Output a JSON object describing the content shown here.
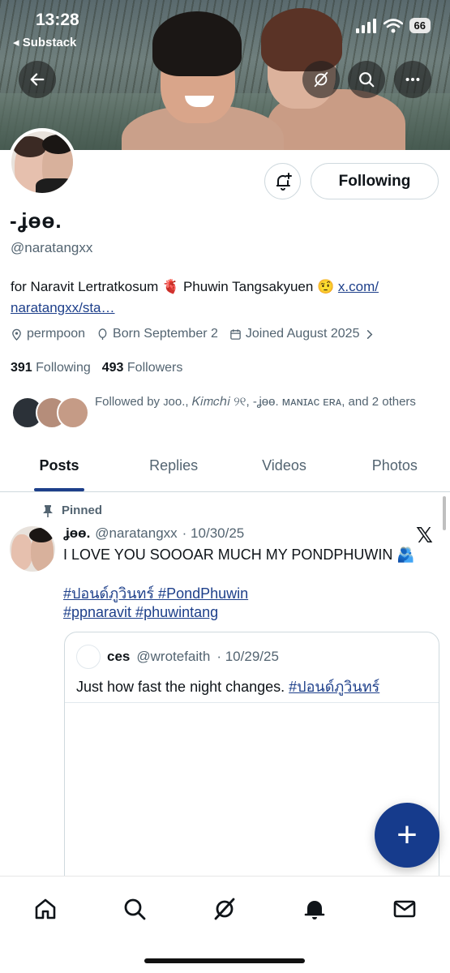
{
  "status_bar": {
    "time": "13:28",
    "back_app": "◂ Substack",
    "battery": "66"
  },
  "header": {
    "back_icon": "arrow-left-icon",
    "grok_icon": "grok-icon",
    "search_icon": "search-icon",
    "more_icon": "more-icon"
  },
  "profile": {
    "display_name": "-ʝɵɵ.",
    "handle": "@naratangxx",
    "bio_text": "for Naravit Lertratkosum 🫀 Phuwin Tangsakyuen 🤨 ",
    "bio_link": "x.com/ naratangxx/sta…",
    "location": "permpoon",
    "birthday": "Born September 2",
    "joined": "Joined August 2025",
    "following_count": "391",
    "following_label": "Following",
    "followers_count": "493",
    "followers_label": "Followers",
    "followed_by": "Followed by ᴊᴏᴏ., 𝐾𝑖𝑚𝑐ℎ𝑖 ୨୧, -ʝɵɵ. ᴍᴀɴɪᴀᴄ ᴇʀᴀ, and 2 others",
    "follow_button": "Following",
    "bell_icon": "bell-plus-icon"
  },
  "tabs": [
    "Posts",
    "Replies",
    "Videos",
    "Photos"
  ],
  "post": {
    "pinned_label": "Pinned",
    "author_name": "ʝɵɵ.",
    "author_handle": "@naratangxx",
    "date": "· 10/30/25",
    "text": "I LOVE YOU SOOOAR MUCH MY PONDPHUWIN 🫂",
    "hashtags_line1": "#ปอนด์ภูวินทร์ #PondPhuwin",
    "hashtags_line2": "#ppnaravit #phuwintang",
    "source_logo": "𝕏",
    "quote": {
      "name": "ces",
      "handle": "@wrotefaith",
      "date": "· 10/29/25",
      "text": "Just how fast the night changes. ",
      "hashtag": "#ปอนด์ภูวินทร์"
    }
  },
  "fab": {
    "label": "+"
  },
  "bottom_nav": [
    "home-icon",
    "search-icon",
    "grok-icon",
    "bell-icon",
    "mail-icon"
  ]
}
